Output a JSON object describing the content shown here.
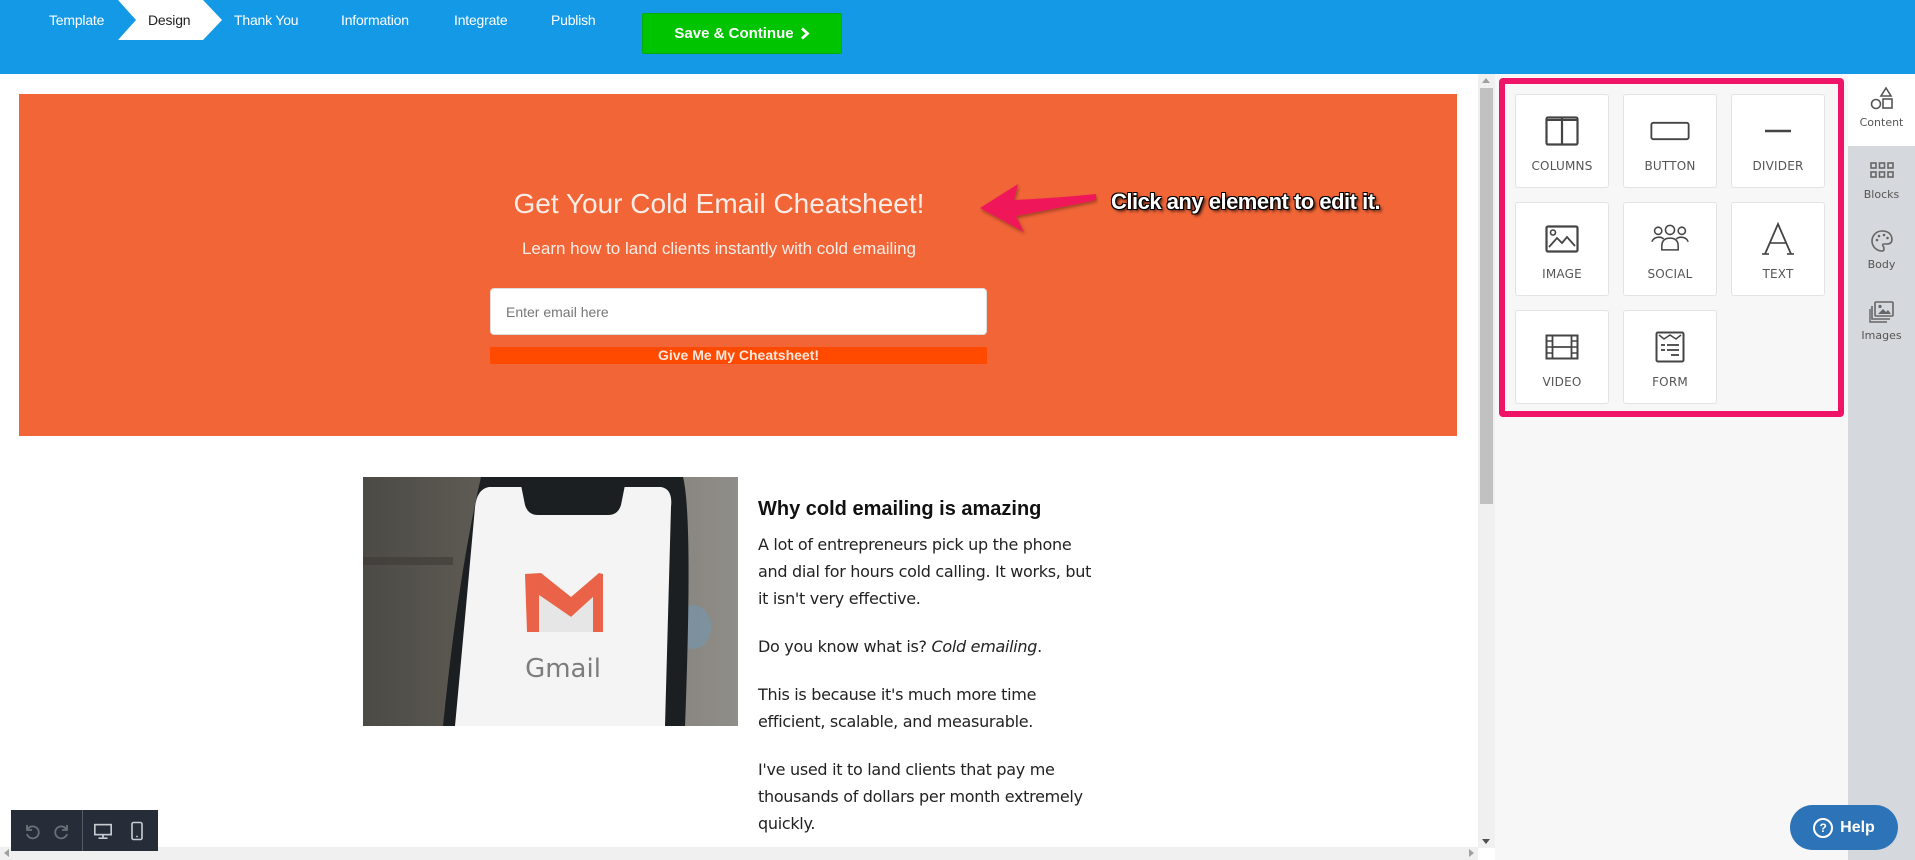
{
  "topbar": {
    "steps": [
      {
        "label": "Template",
        "active": false
      },
      {
        "label": "Design",
        "active": true
      },
      {
        "label": "Thank You",
        "active": false
      },
      {
        "label": "Information",
        "active": false
      },
      {
        "label": "Integrate",
        "active": false
      },
      {
        "label": "Publish",
        "active": false
      }
    ],
    "save_label": "Save & Continue",
    "save_icon": "chevron-right-icon",
    "colors": {
      "bar": "#1399e6",
      "save": "#00c400"
    }
  },
  "hero": {
    "title": "Get Your Cold Email Cheatsheet!",
    "subtitle": "Learn how to land clients instantly with cold emailing",
    "email_placeholder": "Enter email here",
    "email_value": "",
    "cta_label": "Give Me My Cheatsheet!",
    "colors": {
      "background": "#f16537",
      "cta": "#ff4a00"
    }
  },
  "annotation": {
    "text": "Click any element to edit it.",
    "arrow_color": "#f0185a"
  },
  "content": {
    "image_alt": "Gmail",
    "heading": "Why cold emailing is amazing",
    "paragraphs": [
      "A lot of entrepreneurs pick up the phone and dial for hours cold calling. It works, but it isn't very effective.",
      "This is because it's much more time efficient, scalable, and measurable.",
      "I've used it to land clients that pay me thousands of dollars per month extremely quickly."
    ],
    "question_prefix": "Do you know what is? ",
    "question_emphasis": "Cold emailing",
    "question_suffix": "."
  },
  "bottom_toolbar": {
    "undo": "undo-icon",
    "redo": "redo-icon",
    "desktop": "desktop-icon",
    "mobile": "mobile-icon"
  },
  "tools": [
    {
      "label": "COLUMNS",
      "icon": "columns-icon"
    },
    {
      "label": "BUTTON",
      "icon": "button-icon"
    },
    {
      "label": "DIVIDER",
      "icon": "divider-icon"
    },
    {
      "label": "IMAGE",
      "icon": "image-icon"
    },
    {
      "label": "SOCIAL",
      "icon": "social-icon"
    },
    {
      "label": "TEXT",
      "icon": "text-icon"
    },
    {
      "label": "VIDEO",
      "icon": "video-icon"
    },
    {
      "label": "FORM",
      "icon": "form-icon"
    }
  ],
  "tabs": [
    {
      "label": "Content",
      "icon": "shapes-icon",
      "active": true
    },
    {
      "label": "Blocks",
      "icon": "grid-icon",
      "active": false
    },
    {
      "label": "Body",
      "icon": "palette-icon",
      "active": false
    },
    {
      "label": "Images",
      "icon": "images-icon",
      "active": false
    }
  ],
  "help": {
    "label": "Help",
    "icon": "question-circle-icon",
    "color": "#2d73b7"
  },
  "highlight_color": "#ef1468"
}
